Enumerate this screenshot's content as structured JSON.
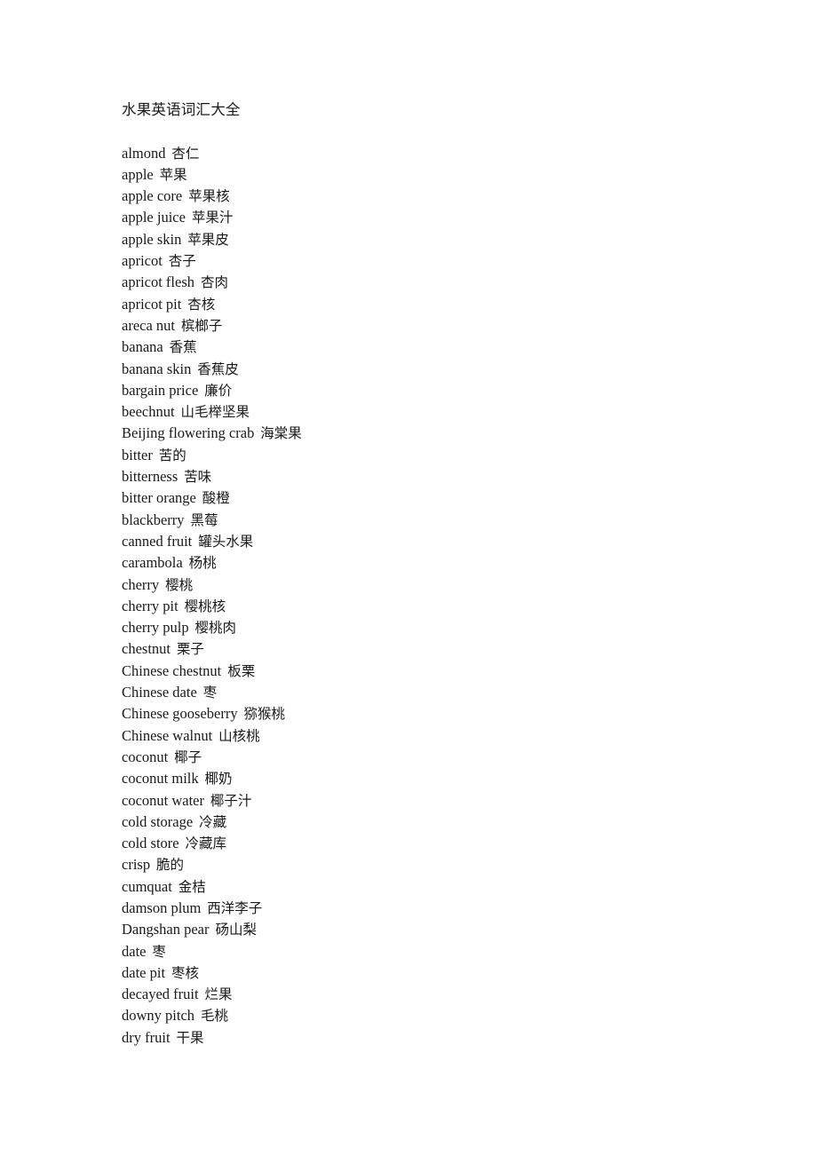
{
  "document": {
    "title": "水果英语词汇大全",
    "background_color": "#ffffff",
    "text_color": "#1a1a1a",
    "entries": [
      {
        "term": "almond",
        "gloss": "杏仁"
      },
      {
        "term": "apple",
        "gloss": "苹果"
      },
      {
        "term": "apple core",
        "gloss": "苹果核"
      },
      {
        "term": "apple juice",
        "gloss": "苹果汁"
      },
      {
        "term": "apple skin",
        "gloss": "苹果皮"
      },
      {
        "term": "apricot",
        "gloss": "杏子"
      },
      {
        "term": "apricot flesh",
        "gloss": "杏肉"
      },
      {
        "term": "apricot pit",
        "gloss": "杏核"
      },
      {
        "term": "areca nut",
        "gloss": "槟榔子"
      },
      {
        "term": "banana",
        "gloss": "香蕉"
      },
      {
        "term": "banana skin",
        "gloss": "香蕉皮"
      },
      {
        "term": "bargain price",
        "gloss": "廉价"
      },
      {
        "term": "beechnut",
        "gloss": "山毛榉坚果"
      },
      {
        "term": "Beijing flowering crab",
        "gloss": "海棠果"
      },
      {
        "term": "bitter",
        "gloss": "苦的"
      },
      {
        "term": "bitterness",
        "gloss": "苦味"
      },
      {
        "term": "bitter orange",
        "gloss": "酸橙"
      },
      {
        "term": "blackberry",
        "gloss": "黑莓"
      },
      {
        "term": "canned fruit",
        "gloss": "罐头水果"
      },
      {
        "term": "carambola",
        "gloss": "杨桃"
      },
      {
        "term": "cherry",
        "gloss": "樱桃"
      },
      {
        "term": "cherry pit",
        "gloss": "樱桃核"
      },
      {
        "term": "cherry pulp",
        "gloss": "樱桃肉"
      },
      {
        "term": "chestnut",
        "gloss": "栗子"
      },
      {
        "term": "Chinese chestnut",
        "gloss": "板栗"
      },
      {
        "term": "Chinese date",
        "gloss": "枣"
      },
      {
        "term": "Chinese gooseberry",
        "gloss": "猕猴桃"
      },
      {
        "term": "Chinese walnut",
        "gloss": "山核桃"
      },
      {
        "term": "coconut",
        "gloss": "椰子"
      },
      {
        "term": "coconut milk",
        "gloss": "椰奶"
      },
      {
        "term": "coconut water",
        "gloss": "椰子汁"
      },
      {
        "term": "cold storage",
        "gloss": "冷藏"
      },
      {
        "term": "cold store",
        "gloss": "冷藏库"
      },
      {
        "term": "crisp",
        "gloss": "脆的"
      },
      {
        "term": "cumquat",
        "gloss": "金桔"
      },
      {
        "term": "damson plum",
        "gloss": "西洋李子"
      },
      {
        "term": "Dangshan pear",
        "gloss": "砀山梨"
      },
      {
        "term": "date",
        "gloss": "枣"
      },
      {
        "term": "date pit",
        "gloss": "枣核"
      },
      {
        "term": "decayed fruit",
        "gloss": "烂果"
      },
      {
        "term": "downy pitch",
        "gloss": "毛桃"
      },
      {
        "term": "dry fruit",
        "gloss": "干果"
      }
    ]
  }
}
